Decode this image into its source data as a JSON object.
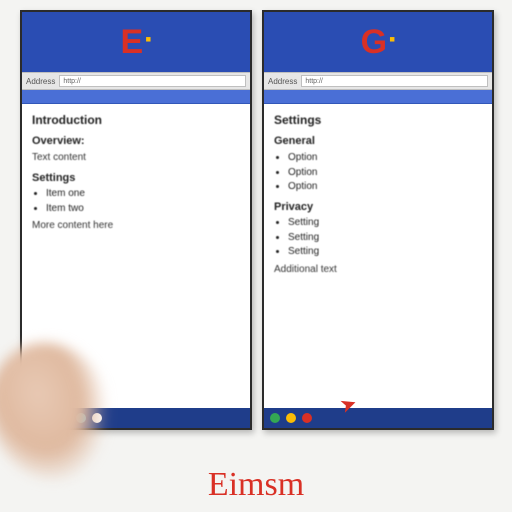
{
  "caption": "Eimsm",
  "left": {
    "logo_letter": "E",
    "address_label": "Address",
    "address_value": "http://",
    "heading": "Introduction",
    "subheading1": "Overview:",
    "para1": "Text content",
    "subheading2": "Settings",
    "list": [
      "Item one",
      "Item two"
    ],
    "para2": "More content here"
  },
  "right": {
    "logo_letter": "G",
    "address_label": "Address",
    "address_value": "http://",
    "heading": "Settings",
    "subheading1": "General",
    "list1": [
      "Option",
      "Option",
      "Option"
    ],
    "subheading2": "Privacy",
    "list2": [
      "Setting",
      "Setting",
      "Setting"
    ],
    "para1": "Additional text"
  }
}
